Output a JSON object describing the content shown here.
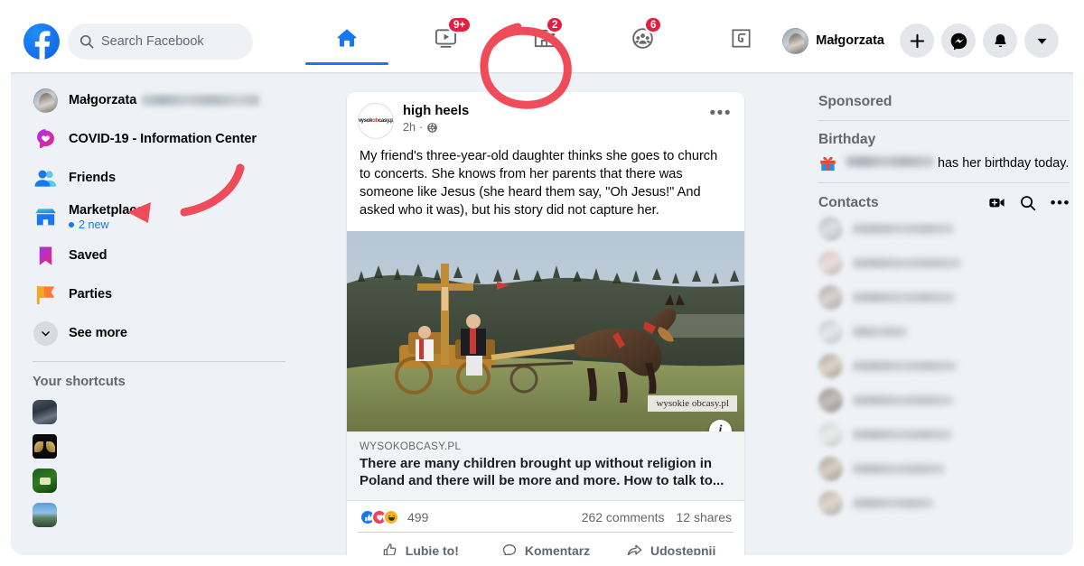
{
  "colors": {
    "brand_blue": "#1877f2",
    "badge_red": "#e41e3f",
    "annotation_red": "#ef4b58",
    "page_bg": "#eef1f5",
    "card_white": "#ffffff",
    "text_primary": "#050505",
    "text_secondary": "#65676b"
  },
  "header": {
    "logo_icon": "facebook-logo-icon",
    "search": {
      "placeholder": "Search Facebook",
      "value": "",
      "icon": "search-icon"
    },
    "nav_tabs": [
      {
        "name": "home",
        "icon": "home-icon",
        "active": true,
        "badge": ""
      },
      {
        "name": "watch",
        "icon": "video-watch-icon",
        "active": false,
        "badge": "9+"
      },
      {
        "name": "marketplace",
        "icon": "marketplace-store-icon",
        "active": false,
        "badge": "2"
      },
      {
        "name": "groups",
        "icon": "groups-icon",
        "active": false,
        "badge": "6"
      },
      {
        "name": "gaming",
        "icon": "gaming-icon",
        "active": false,
        "badge": ""
      }
    ],
    "profile": {
      "name": "Małgorzata",
      "avatar_icon": "user-avatar"
    },
    "actions": [
      {
        "name": "create",
        "icon": "plus-icon"
      },
      {
        "name": "messenger",
        "icon": "messenger-icon"
      },
      {
        "name": "notifications",
        "icon": "bell-icon"
      },
      {
        "name": "account-menu",
        "icon": "chevron-down-icon"
      }
    ]
  },
  "sidebar": {
    "items": [
      {
        "label": "Małgorzata",
        "icon": "user-avatar",
        "name_redacted": true,
        "sub": ""
      },
      {
        "label": "COVID-19 - Information Center",
        "icon": "covid-info-icon",
        "sub": ""
      },
      {
        "label": "Friends",
        "icon": "friends-icon",
        "sub": ""
      },
      {
        "label": "Marketplace",
        "icon": "marketplace-store-icon",
        "sub": "2 new"
      },
      {
        "label": "Saved",
        "icon": "saved-bookmark-icon",
        "sub": ""
      },
      {
        "label": "Parties",
        "icon": "parties-flag-icon",
        "sub": ""
      },
      {
        "label": "See more",
        "icon": "chevron-down-icon",
        "sub": ""
      }
    ],
    "shortcuts_title": "Your shortcuts",
    "shortcuts": [
      {
        "label": "",
        "thumb": "city-night-thumbnail"
      },
      {
        "label": "",
        "thumb": "golden-wings-thumbnail"
      },
      {
        "label": "",
        "thumb": "green-field-thumbnail"
      },
      {
        "label": "",
        "thumb": "blue-skyline-thumbnail"
      }
    ]
  },
  "feed": {
    "post": {
      "page_name": "high heels",
      "page_logo_text": "wysokobcasy.pl",
      "time": "2h",
      "privacy_icon": "globe-icon",
      "menu_icon": "ellipsis-icon",
      "text": "My friend's three-year-old daughter thinks she goes to church to concerts. She knows from her parents that there was someone like Jesus (she heard them say, \"Oh Jesus!\" And asked who it was), but his story did not capture her.",
      "image_alt": "Horse-drawn carriage carrying a wooden crucifix with men in traditional Polish highlander dress on a hilltop",
      "image_watermark": "wysokie obcasy.pl",
      "info_button": "i",
      "link": {
        "domain": "WYSOKOBCASY.PL",
        "title": "There are many children brought up without religion in Poland and there will be more and more. How to talk to..."
      },
      "reactions": {
        "icons": [
          "like-reaction-icon",
          "love-reaction-icon",
          "haha-reaction-icon"
        ],
        "count": "499"
      },
      "comments": "262 comments",
      "shares": "12 shares",
      "actions": [
        {
          "label": "Lubię to!",
          "icon": "thumbs-up-icon"
        },
        {
          "label": "Komentarz",
          "icon": "comment-bubble-icon"
        },
        {
          "label": "Udostępnij",
          "icon": "share-arrow-icon"
        }
      ]
    }
  },
  "right_sidebar": {
    "sponsored_title": "Sponsored",
    "birthday_title": "Birthday",
    "birthday_icon": "gift-icon",
    "birthday_text": "has her birthday today.",
    "birthday_name_redacted": true,
    "contacts_title": "Contacts",
    "contacts_actions": [
      {
        "name": "new-video-room",
        "icon": "video-camera-plus-icon"
      },
      {
        "name": "search-contacts",
        "icon": "search-icon"
      },
      {
        "name": "contacts-options",
        "icon": "ellipsis-icon"
      }
    ],
    "contacts": [
      {
        "name_redacted": true,
        "width": 112
      },
      {
        "name_redacted": true,
        "width": 120
      },
      {
        "name_redacted": true,
        "width": 113
      },
      {
        "name_redacted": true,
        "width": 60
      },
      {
        "name_redacted": true,
        "width": 115
      },
      {
        "name_redacted": true,
        "width": 111
      },
      {
        "name_redacted": true,
        "width": 110
      },
      {
        "name_redacted": true,
        "width": 102
      },
      {
        "name_redacted": true,
        "width": 89
      }
    ]
  },
  "annotations": {
    "highlight_circle": {
      "target": "marketplace-nav-tab",
      "shape": "hand-drawn-circle",
      "color": "#ef4b58"
    },
    "arrow": {
      "target": "sidebar-item-marketplace",
      "shape": "curved-arrow-pointing-left",
      "color": "#ef4b58"
    }
  }
}
